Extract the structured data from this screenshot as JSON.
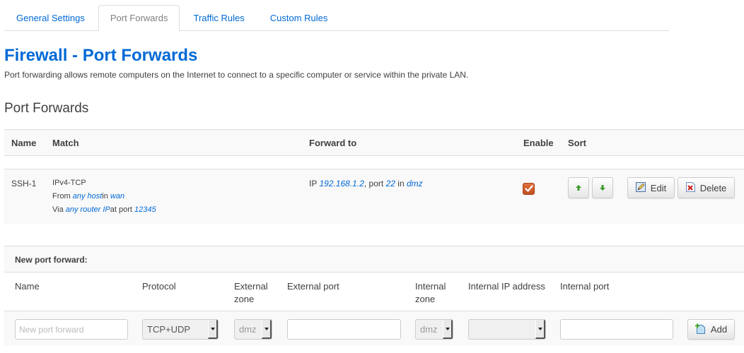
{
  "tabs": [
    {
      "label": "General Settings",
      "active": false
    },
    {
      "label": "Port Forwards",
      "active": true
    },
    {
      "label": "Traffic Rules",
      "active": false
    },
    {
      "label": "Custom Rules",
      "active": false
    }
  ],
  "page": {
    "title": "Firewall - Port Forwards",
    "description": "Port forwarding allows remote computers on the Internet to connect to a specific computer or service within the private LAN.",
    "section_title": "Port Forwards"
  },
  "table": {
    "headers": {
      "name": "Name",
      "match": "Match",
      "forward_to": "Forward to",
      "enable": "Enable",
      "sort": "Sort"
    },
    "rows": [
      {
        "name": "SSH-1",
        "match": {
          "protocol": "IPv4-TCP",
          "from_prefix": "From",
          "from_host": "any host",
          "from_in": "in",
          "from_zone": "wan",
          "via_prefix": "Via",
          "via_ip": "any router IP",
          "via_port_prefix": "at port",
          "via_port": "12345"
        },
        "forward": {
          "ip_prefix": "IP",
          "ip": "192.168.1.2",
          "port_prefix": ", port",
          "port": "22",
          "in": "in",
          "zone": "dmz"
        },
        "enabled": true,
        "edit_label": "Edit",
        "delete_label": "Delete",
        "move_up_icon": "arrow-up-icon",
        "move_down_icon": "arrow-down-icon"
      }
    ]
  },
  "new_forward": {
    "header": "New port forward:",
    "columns": {
      "name": "Name",
      "protocol": "Protocol",
      "external_zone_1": "External",
      "external_zone_2": "zone",
      "external_port": "External port",
      "internal_zone_1": "Internal",
      "internal_zone_2": "zone",
      "internal_ip": "Internal IP address",
      "internal_port": "Internal port"
    },
    "inputs": {
      "name_placeholder": "New port forward",
      "name_value": "",
      "protocol": "TCP+UDP",
      "external_zone": "dmz",
      "external_port": "",
      "internal_zone": "dmz",
      "internal_ip": "",
      "internal_port": ""
    },
    "add_label": "Add"
  },
  "colors": {
    "link": "#0069d6",
    "checkbox": "#d2602d",
    "arrow_green": "#3c9a2a",
    "delete_red": "#d01f1f"
  }
}
